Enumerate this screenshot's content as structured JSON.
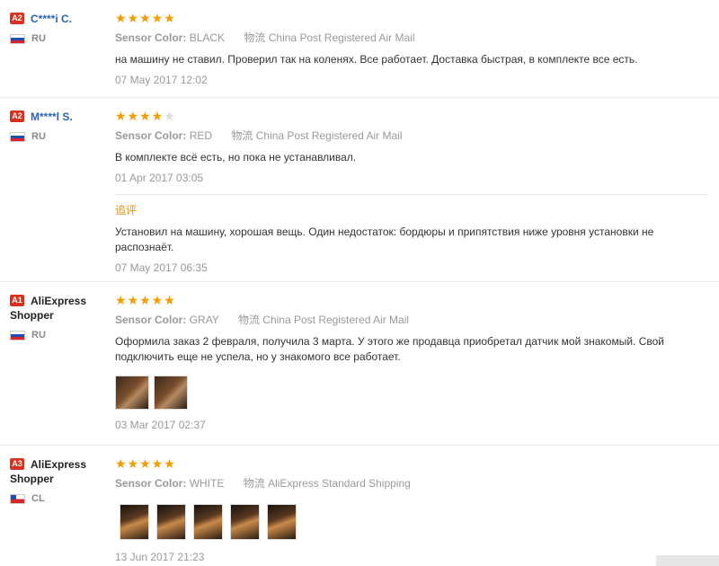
{
  "labels": {
    "sensor_color": "Sensor Color:",
    "shipping": "物流",
    "followup": "追评"
  },
  "colors": {
    "star": "#f49b00",
    "badge": "#d9311d",
    "link": "#2a63b8"
  },
  "reviews": [
    {
      "badge": "A2",
      "name": "C****i C.",
      "country": "RU",
      "rating": 5,
      "sensor_color": "BLACK",
      "shipping": "China Post Registered Air Mail",
      "text": "на машину не ставил. Проверил так на коленях. Все работает. Доставка быстрая, в комплекте все есть.",
      "date": "07 May 2017 12:02"
    },
    {
      "badge": "A2",
      "name": "M****l S.",
      "country": "RU",
      "rating": 4,
      "sensor_color": "RED",
      "shipping": "China Post Registered Air Mail",
      "text": "В комплекте всё есть, но пока не устанавливал.",
      "date": "01 Apr 2017 03:05",
      "followup_text": "Установил на машину, хорошая вещь. Один недостаток: бордюры и припятствия ниже уровня установки не распознаёт.",
      "followup_date": "07 May 2017 06:35"
    },
    {
      "badge": "A1",
      "name": "AliExpress Shopper",
      "country": "RU",
      "rating": 5,
      "sensor_color": "GRAY",
      "shipping": "China Post Registered Air Mail",
      "text": "Оформила заказ 2 февраля, получила 3 марта. У этого же продавца приобретал датчик мой знакомый. Свой подключить еще не успела, но у знакомого все работает.",
      "date": "03 Mar 2017 02:37"
    },
    {
      "badge": "A3",
      "name": "AliExpress Shopper",
      "country": "CL",
      "rating": 5,
      "sensor_color": "WHITE",
      "shipping": "AliExpress Standard Shipping",
      "date": "13 Jun 2017 21:23"
    }
  ]
}
